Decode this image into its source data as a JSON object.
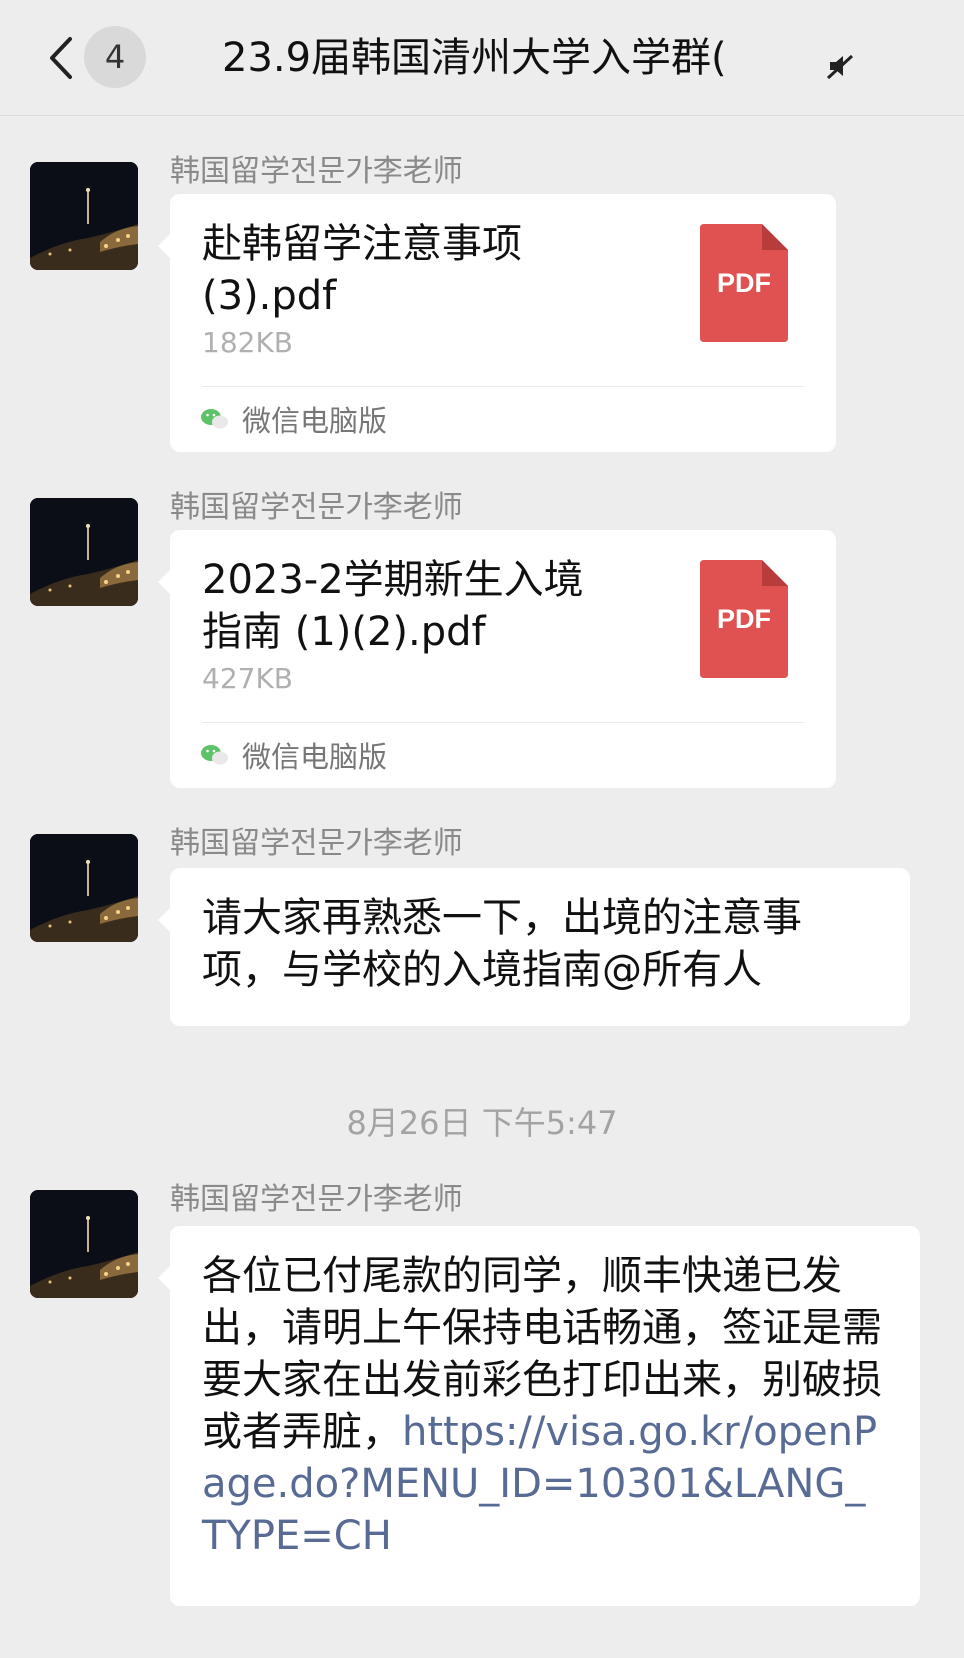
{
  "header": {
    "back_icon": "chevron-left-icon",
    "unread_count": "4",
    "title": "23.9届韩国清州大学入学群(",
    "mute_icon": "mute-icon"
  },
  "messages": [
    {
      "sender": "韩国留学전문가李老师",
      "type": "file",
      "file_name": "赴韩留学注意事项\n(3).pdf",
      "file_size": "182KB",
      "file_icon_label": "PDF",
      "source_label": "微信电脑版"
    },
    {
      "sender": "韩国留学전문가李老师",
      "type": "file",
      "file_name": "2023-2学期新生入境\n指南 (1)(2).pdf",
      "file_size": "427KB",
      "file_icon_label": "PDF",
      "source_label": "微信电脑版"
    },
    {
      "sender": "韩国留学전문가李老师",
      "type": "text",
      "text": "请大家再熟悉一下，出境的注意事项，与学校的入境指南@所有人"
    },
    {
      "sender": "韩国留学전문가李老师",
      "type": "text",
      "text": "各位已付尾款的同学，顺丰快递已发出，请明上午保持电话畅通，签证是需要大家在出发前彩色打印出来，别破损或者弄脏，",
      "link": "https://visa.go.kr/openPage.do?MENU_ID=10301&LANG_TYPE=CH"
    }
  ],
  "timestamp": "8月26日 下午5:47",
  "colors": {
    "background": "#ededed",
    "bubble": "#ffffff",
    "pdf_red": "#e05252",
    "link": "#576b95"
  }
}
